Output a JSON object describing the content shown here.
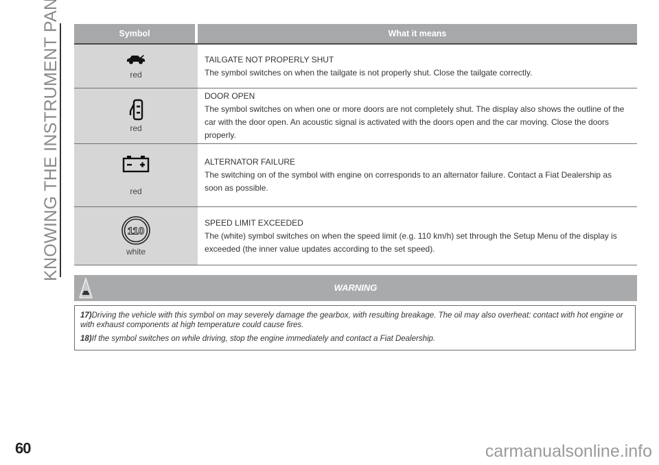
{
  "section_title": "KNOWING THE INSTRUMENT PANEL",
  "table": {
    "headers": {
      "symbol": "Symbol",
      "meaning": "What it means"
    },
    "rows": [
      {
        "icon": "tailgate-open-icon",
        "color": "red",
        "title": "TAILGATE NOT PROPERLY SHUT",
        "text": "The symbol switches on when the tailgate is not properly shut. Close the tailgate correctly."
      },
      {
        "icon": "door-open-icon",
        "color": "red",
        "title": "DOOR OPEN",
        "text": "The symbol switches on when one or more doors are not completely shut. The display also shows the outline of the car with the door open. An acoustic signal is activated with the doors open and the car moving. Close the doors properly."
      },
      {
        "icon": "battery-icon",
        "color": "red",
        "title": "ALTERNATOR FAILURE",
        "text": "The switching on of the symbol with engine on corresponds to an alternator failure. Contact a Fiat Dealership as soon as possible."
      },
      {
        "icon": "speed-limit-icon",
        "color": "white",
        "speed_value": "110",
        "title": "SPEED LIMIT EXCEEDED",
        "text": "The (white) symbol switches on when the speed limit (e.g. 110 km/h) set through the Setup Menu of the display is exceeded (the inner value updates according to the set speed)."
      }
    ]
  },
  "warning": {
    "title": "WARNING",
    "icon": "warning-car-icon",
    "notes": [
      {
        "num": "17)",
        "text": "Driving the vehicle with this symbol on may severely damage the gearbox, with resulting breakage. The oil may also overheat: contact with hot engine or with exhaust components at high temperature could cause fires."
      },
      {
        "num": "18)",
        "text": "If the symbol switches on while driving, stop the engine immediately and contact a Fiat Dealership."
      }
    ]
  },
  "page_number": "60",
  "watermark": "carmanualsonline.info"
}
